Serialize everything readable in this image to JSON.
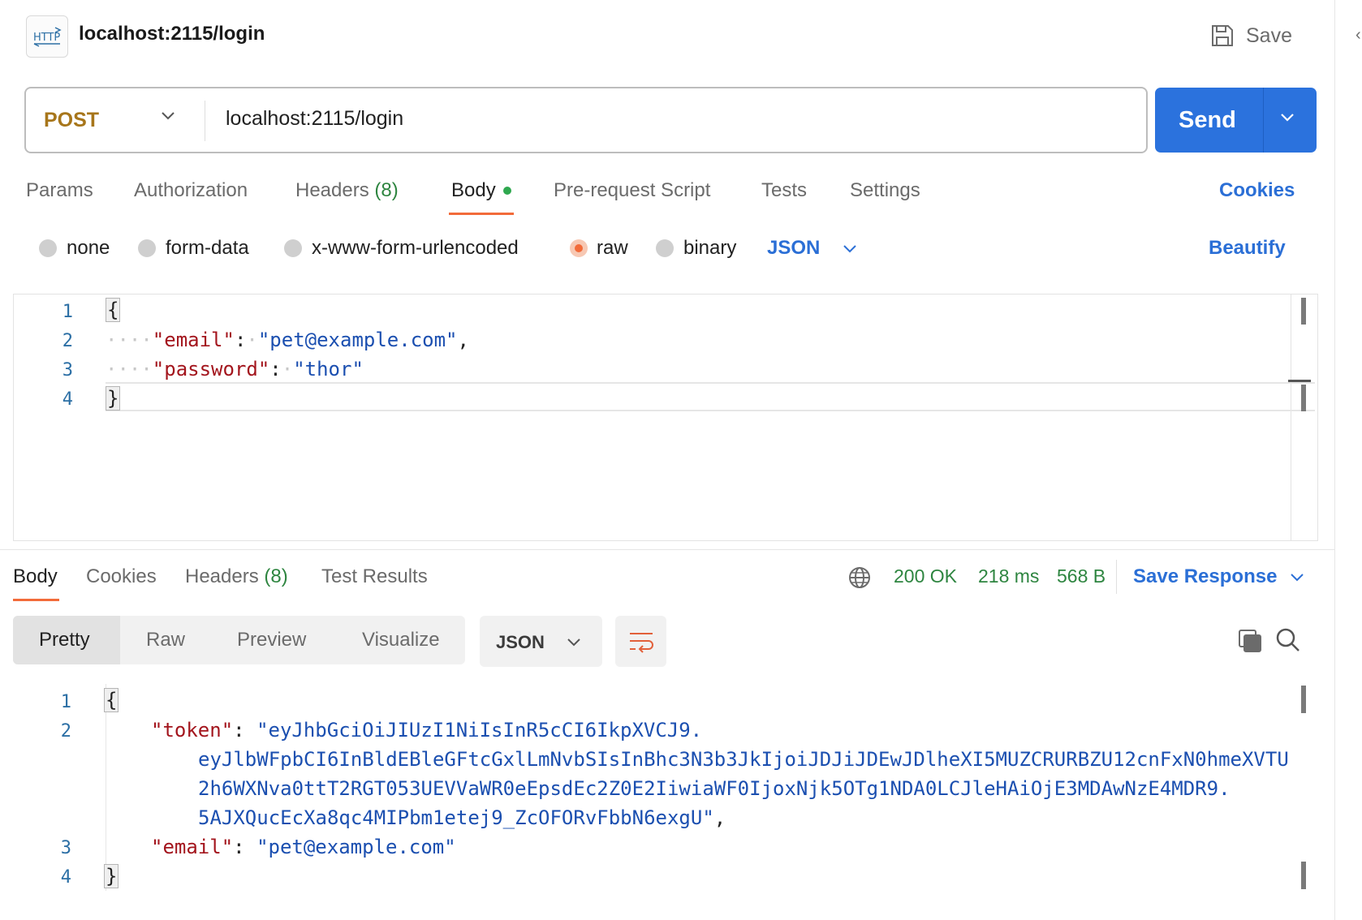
{
  "header": {
    "icon_label": "HTTP",
    "title": "localhost:2115/login",
    "save_label": "Save"
  },
  "request": {
    "method": "POST",
    "url": "localhost:2115/login",
    "send_label": "Send"
  },
  "request_tabs": {
    "params": "Params",
    "authorization": "Authorization",
    "headers": "Headers",
    "headers_count": "(8)",
    "body": "Body",
    "pre_request": "Pre-request Script",
    "tests": "Tests",
    "settings": "Settings",
    "cookies": "Cookies"
  },
  "body_modes": {
    "none": "none",
    "form_data": "form-data",
    "urlencoded": "x-www-form-urlencoded",
    "raw": "raw",
    "binary": "binary",
    "selected": "raw",
    "format": "JSON",
    "beautify": "Beautify"
  },
  "request_body": {
    "line_numbers": [
      "1",
      "2",
      "3",
      "4"
    ],
    "open_brace": "{",
    "close_brace": "}",
    "fields": [
      {
        "key": "\"email\"",
        "value": "\"pet@example.com\""
      },
      {
        "key": "\"password\"",
        "value": "\"thor\""
      }
    ]
  },
  "response_tabs": {
    "body": "Body",
    "cookies": "Cookies",
    "headers": "Headers",
    "headers_count": "(8)",
    "test_results": "Test Results"
  },
  "response_status": {
    "status": "200 OK",
    "time": "218 ms",
    "size": "568 B",
    "save_response": "Save Response"
  },
  "response_view": {
    "modes": [
      "Pretty",
      "Raw",
      "Preview",
      "Visualize"
    ],
    "active_mode": "Pretty",
    "format": "JSON"
  },
  "response_body": {
    "line_numbers": [
      "1",
      "2",
      "3",
      "4"
    ],
    "open_brace": "{",
    "close_brace": "}",
    "token_key": "\"token\"",
    "token_lines": [
      "\"eyJhbGciOiJIUzI1NiIsInR5cCI6IkpXVCJ9.",
      "eyJlbWFpbCI6InBldEBleGFtcGxlLmNvbSIsInBhc3N3b3JkIjoiJDJiJDEwJDlheXI5MUZCRURBZU12cnFxN0hmeXVTU",
      "2h6WXNva0ttT2RGT053UEVVaWR0eEpsdEc2Z0E2IiwiaWF0IjoxNjk5OTg1NDA0LCJleHAiOjE3MDAwNzE4MDR9.",
      "5AJXQucEcXa8qc4MIPbm1etej9_ZcOFORvFbbN6exgU\""
    ],
    "email_key": "\"email\"",
    "email_value": "\"pet@example.com\""
  },
  "colors": {
    "accent": "#2b72dd",
    "active_tab": "#f26b3a",
    "method": "#a7761b",
    "status": "#2e8540"
  }
}
